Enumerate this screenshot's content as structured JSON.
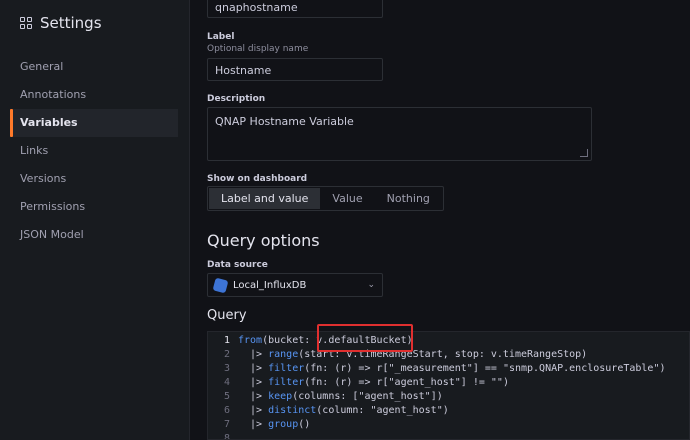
{
  "sidebar": {
    "title": "Settings",
    "items": [
      {
        "label": "General"
      },
      {
        "label": "Annotations"
      },
      {
        "label": "Variables"
      },
      {
        "label": "Links"
      },
      {
        "label": "Versions"
      },
      {
        "label": "Permissions"
      },
      {
        "label": "JSON Model"
      }
    ],
    "active": "Variables"
  },
  "form": {
    "name_value": "qnaphostname",
    "label_label": "Label",
    "label_desc": "Optional display name",
    "label_value": "Hostname",
    "description_label": "Description",
    "description_value": "QNAP Hostname Variable",
    "show_label": "Show on dashboard",
    "show_options": [
      "Label and value",
      "Value",
      "Nothing"
    ],
    "show_selected": "Label and value"
  },
  "query_options": {
    "title": "Query options",
    "ds_label": "Data source",
    "ds_value": "Local_InfluxDB",
    "query_title": "Query"
  },
  "code": {
    "lines": [
      {
        "n": "1",
        "text": "from(bucket: v.defaultBucket)"
      },
      {
        "n": "2",
        "text": "  |> range(start: v.timeRangeStart, stop: v.timeRangeStop)"
      },
      {
        "n": "3",
        "text": "  |> filter(fn: (r) => r[\"_measurement\"] == \"snmp.QNAP.enclosureTable\")"
      },
      {
        "n": "4",
        "text": "  |> filter(fn: (r) => r[\"agent_host\"] != \"\")"
      },
      {
        "n": "5",
        "text": "  |> keep(columns: [\"agent_host\"])"
      },
      {
        "n": "6",
        "text": "  |> distinct(column: \"agent_host\")"
      },
      {
        "n": "7",
        "text": "  |> group()"
      },
      {
        "n": "8",
        "text": ""
      }
    ]
  },
  "colors": {
    "accent": "#ff7a2a",
    "highlight": "#e02f2f"
  }
}
